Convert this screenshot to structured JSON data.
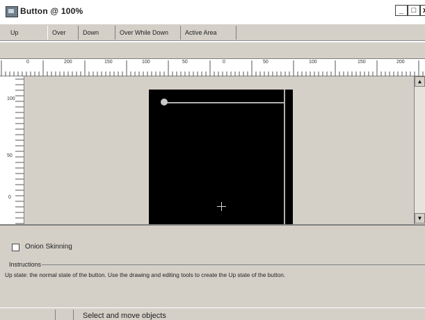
{
  "window": {
    "title": "Button @ 100%"
  },
  "window_controls": {
    "minimize": "_",
    "maximize": "□",
    "close": "x"
  },
  "tabs": [
    "Up",
    "Over",
    "Down",
    "Over While Down",
    "Active Area"
  ],
  "ruler": {
    "top_labels": [
      "0",
      "200",
      "150",
      "100",
      "50",
      "0",
      "50",
      "100",
      "150",
      "200"
    ],
    "left_labels": [
      "100",
      "50",
      "0"
    ]
  },
  "onion_skinning": {
    "label": "Onion Skinning",
    "checked": false
  },
  "instructions": {
    "legend": "Instructions",
    "text": "Up state: the normal state of the button. Use the drawing and editing tools to create the Up state of the button."
  },
  "status_bar": {
    "message": "Select and move objects"
  },
  "colors": {
    "chrome": "#d4d0c8",
    "stage": "#000000",
    "ruler": "#ffffff"
  }
}
